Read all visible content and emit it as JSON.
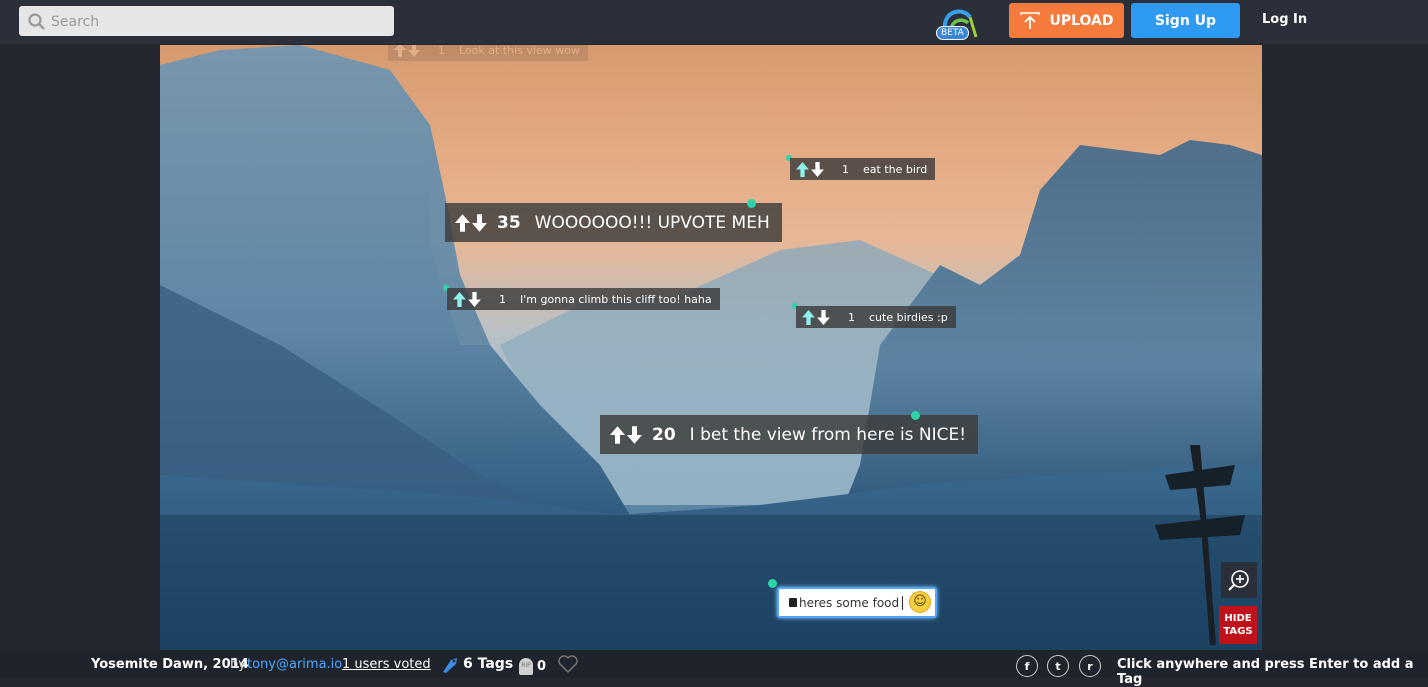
{
  "search": {
    "placeholder": "Search"
  },
  "logo": {
    "badge": "BETA"
  },
  "header": {
    "upload_label": "UPLOAD",
    "signup_label": "Sign Up",
    "login_label": "Log In"
  },
  "tags": [
    {
      "count": "1",
      "text": "Look at this view wow"
    },
    {
      "count": "1",
      "text": "eat the bird"
    },
    {
      "count": "35",
      "text": "WOOOOOO!!! UPVOTE MEH"
    },
    {
      "count": "1",
      "text": "I'm gonna climb this cliff too! haha"
    },
    {
      "count": "1",
      "text": "cute birdies :p"
    },
    {
      "count": "20",
      "text": "I bet the view from here is NICE!"
    }
  ],
  "tag_input": {
    "value": "heres some food"
  },
  "controls": {
    "hide_tags_line1": "HIDE",
    "hide_tags_line2": "TAGS"
  },
  "footer": {
    "title": "Yosemite Dawn, 2014",
    "by": "by",
    "user": "tony@arima.io",
    "voted": "1 users voted",
    "tag_count": "6 Tags",
    "rip_badge": "RIP",
    "rip_count": "0",
    "hint": "Click anywhere and press Enter to add a Tag"
  },
  "social": [
    "f",
    "t",
    "r"
  ],
  "colors": {
    "upload": "#f47b3c",
    "signup": "#2f9af1",
    "hide": "#c0121b",
    "pin": "#2ed3a8"
  }
}
